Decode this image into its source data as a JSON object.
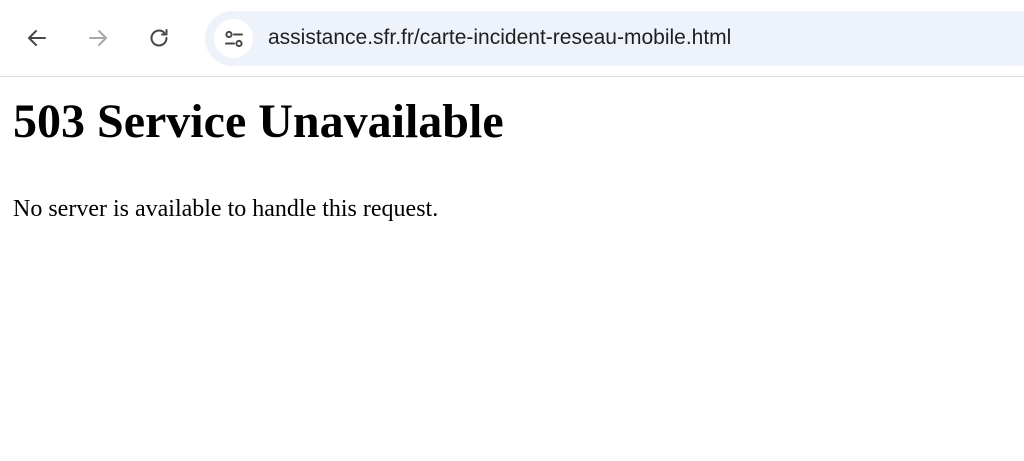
{
  "browser": {
    "url": "assistance.sfr.fr/carte-incident-reseau-mobile.html",
    "icons": {
      "back": "arrow-left-icon",
      "forward": "arrow-right-icon",
      "reload": "reload-icon",
      "site_info": "tune-icon"
    },
    "forward_disabled": true,
    "colors": {
      "icon": "#474747",
      "icon_disabled": "#a8a8a8",
      "omnibox_bg": "#eef2fa"
    }
  },
  "page": {
    "title": "503 Service Unavailable",
    "message": "No server is available to handle this request."
  }
}
